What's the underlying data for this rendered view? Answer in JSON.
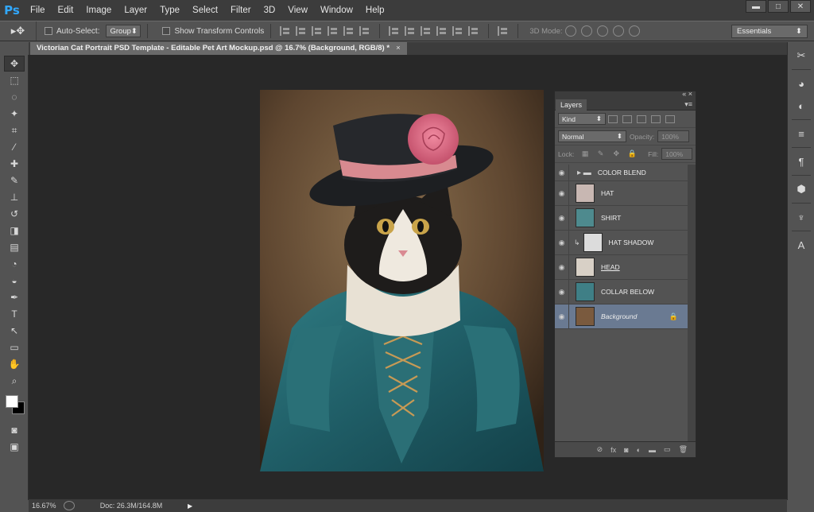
{
  "app": {
    "logo": "Ps",
    "menu": [
      "File",
      "Edit",
      "Image",
      "Layer",
      "Type",
      "Select",
      "Filter",
      "3D",
      "View",
      "Window",
      "Help"
    ],
    "window_buttons": {
      "minimize": "▬",
      "maximize": "□",
      "close": "✕"
    }
  },
  "options_bar": {
    "tool_glyph": "▸✥",
    "auto_select_label": "Auto-Select:",
    "auto_select_value": "Group",
    "show_transform_label": "Show Transform Controls",
    "mode_3d_label": "3D Mode:",
    "workspace": "Essentials"
  },
  "document": {
    "tab_title": "Victorian Cat Portrait PSD Template - Editable Pet Art Mockup.psd @ 16.7% (Background, RGB/8) *",
    "tab_close": "×"
  },
  "toolbar": {
    "tools": [
      {
        "name": "move-tool",
        "glyph": "✥"
      },
      {
        "name": "marquee-tool",
        "glyph": "⬚"
      },
      {
        "name": "lasso-tool",
        "glyph": "◌"
      },
      {
        "name": "quick-select-tool",
        "glyph": "✦"
      },
      {
        "name": "crop-tool",
        "glyph": "⌗"
      },
      {
        "name": "eyedropper-tool",
        "glyph": "⁄"
      },
      {
        "name": "healing-brush-tool",
        "glyph": "✚"
      },
      {
        "name": "brush-tool",
        "glyph": "✎"
      },
      {
        "name": "clone-stamp-tool",
        "glyph": "⊥"
      },
      {
        "name": "history-brush-tool",
        "glyph": "↺"
      },
      {
        "name": "eraser-tool",
        "glyph": "◨"
      },
      {
        "name": "gradient-tool",
        "glyph": "▤"
      },
      {
        "name": "blur-tool",
        "glyph": "◔"
      },
      {
        "name": "dodge-tool",
        "glyph": "◒"
      },
      {
        "name": "pen-tool",
        "glyph": "✒"
      },
      {
        "name": "type-tool",
        "glyph": "T"
      },
      {
        "name": "path-select-tool",
        "glyph": "↖"
      },
      {
        "name": "shape-tool",
        "glyph": "▭"
      },
      {
        "name": "hand-tool",
        "glyph": "✋"
      },
      {
        "name": "zoom-tool",
        "glyph": "⌕"
      }
    ],
    "foreground_color": "#ffffff",
    "background_color": "#000000",
    "quick_mask_glyph": "◙",
    "screen_mode_glyph": "▣"
  },
  "right_dock": {
    "icons": [
      {
        "name": "tools-panel-icon",
        "glyph": "✂"
      },
      {
        "name": "color-panel-icon",
        "glyph": "◕"
      },
      {
        "name": "adjustments-icon",
        "glyph": "◐"
      },
      {
        "name": "properties-icon",
        "glyph": "≡"
      },
      {
        "name": "paragraph-icon",
        "glyph": "¶"
      },
      {
        "name": "3d-icon",
        "glyph": "⬢"
      },
      {
        "name": "brush-presets-icon",
        "glyph": "♆"
      },
      {
        "name": "character-icon",
        "glyph": "A"
      }
    ]
  },
  "layers_panel": {
    "tab": "Layers",
    "filter_kind": "Kind",
    "blend_mode": "Normal",
    "opacity_label": "Opacity:",
    "opacity_value": "100%",
    "lock_label": "Lock:",
    "fill_label": "Fill:",
    "fill_value": "100%",
    "layers": [
      {
        "name": "COLOR BLEND",
        "type": "group"
      },
      {
        "name": "HAT",
        "type": "layer",
        "thumb": "#c8b7b2"
      },
      {
        "name": "SHIRT",
        "type": "layer",
        "thumb": "#4e8a8e"
      },
      {
        "name": "HAT SHADOW",
        "type": "clipped",
        "thumb": "#dcdcdc"
      },
      {
        "name": "HEAD",
        "type": "layer",
        "thumb": "#d8d0c6"
      },
      {
        "name": "COLLAR BELOW",
        "type": "layer",
        "thumb": "#3f7f86"
      },
      {
        "name": "Background",
        "type": "background",
        "thumb": "#7a5a3e"
      }
    ],
    "footer_icons": [
      "⊘",
      "fx",
      "◙",
      "◐",
      "▬",
      "▭",
      "🗑"
    ]
  },
  "status_bar": {
    "zoom": "16.67%",
    "doc_size": "Doc: 26.3M/164.8M",
    "arrow": "▶"
  },
  "colors": {
    "chrome_dark": "#3c3c3c",
    "chrome_mid": "#535353",
    "canvas_bg": "#282828",
    "selection": "#6a7a92",
    "ps_blue": "#31a8ff"
  }
}
